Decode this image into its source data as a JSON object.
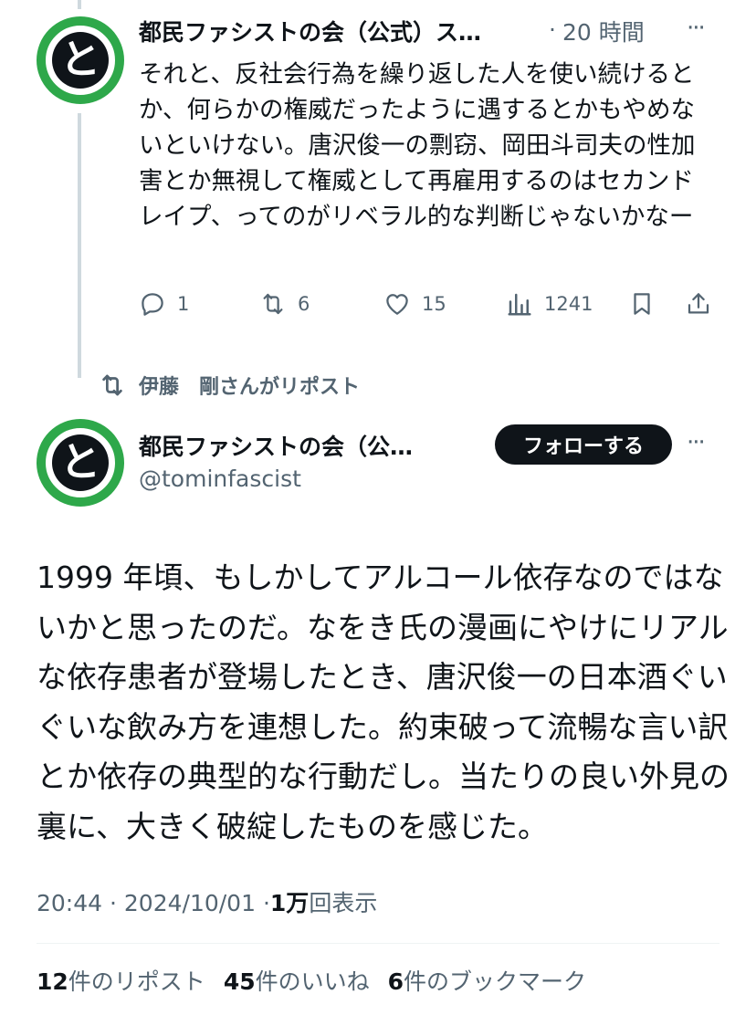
{
  "tweet1": {
    "avatar_glyph": "と",
    "author": "都民ファシストの会（公式）ス…",
    "separator": "·",
    "time": "20 時間",
    "more": "···",
    "text": "それと、反社会行為を繰り返した人を使い続けるとか、何らかの権威だったように遇するとかもやめないといけない。唐沢俊一の剽窃、岡田斗司夫の性加害とか無視して権威として再雇用するのはセカンドレイプ、ってのがリベラル的な判断じゃないかなー",
    "replies": "1",
    "reposts": "6",
    "likes": "15",
    "views": "1241"
  },
  "repost_banner": {
    "text": "伊藤　剛さんがリポスト"
  },
  "tweet2": {
    "avatar_glyph": "と",
    "author": "都民ファシストの会（公…",
    "handle": "@tominfascist",
    "follow_label": "フォローする",
    "more": "···",
    "text": "1999 年頃、もしかしてアルコール依存なのではないかと思ったのだ。なをき氏の漫画にやけにリアルな依存患者が登場したとき、唐沢俊一の日本酒ぐいぐいな飲み方を連想した。約束破って流暢な言い訳とか依存の典型的な行動だし。当たりの良い外見の裏に、大きく破綻したものを感じた。",
    "time": "20:44",
    "sep1": "·",
    "date": "2024/10/01",
    "sep2": "·",
    "views_num": "1万",
    "views_label": "回表示",
    "reposts_num": "12",
    "reposts_label": "件のリポスト",
    "likes_num": "45",
    "likes_label": "件のいいね",
    "bookmarks_num": "6",
    "bookmarks_label": "件のブックマーク"
  },
  "icons": [
    "reply-icon",
    "repost-icon",
    "like-icon",
    "views-icon",
    "bookmark-icon",
    "share-icon",
    "more-icon"
  ],
  "colors": {
    "text": "#0f1419",
    "secondary": "#536471",
    "avatar_ring": "#2ea84a",
    "thread_line": "#cfd9de",
    "follow_button": "#0f1419"
  }
}
